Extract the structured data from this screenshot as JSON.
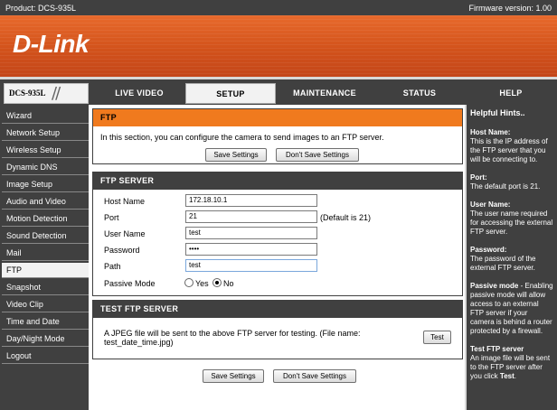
{
  "top": {
    "product": "Product: DCS-935L",
    "firmware": "Firmware version: 1.00"
  },
  "brand": {
    "logo": "D-Link"
  },
  "nav": {
    "model": "DCS-935L",
    "tabs": {
      "live": "LIVE VIDEO",
      "setup": "SETUP",
      "maintenance": "MAINTENANCE",
      "status": "STATUS",
      "help": "HELP"
    },
    "active": "SETUP"
  },
  "sidebar": {
    "items": [
      "Wizard",
      "Network Setup",
      "Wireless Setup",
      "Dynamic DNS",
      "Image Setup",
      "Audio and Video",
      "Motion Detection",
      "Sound Detection",
      "Mail",
      "FTP",
      "Snapshot",
      "Video Clip",
      "Time and Date",
      "Day/Night Mode",
      "Logout"
    ],
    "active": "FTP"
  },
  "ftp_box": {
    "title": "FTP",
    "description": "In this section, you can configure the camera to send images to an FTP server.",
    "save_label": "Save Settings",
    "dont_save_label": "Don't Save Settings"
  },
  "server_box": {
    "title": "FTP SERVER",
    "host_label": "Host Name",
    "host_value": "172.18.10.1",
    "port_label": "Port",
    "port_value": "21",
    "port_note": "(Default is 21)",
    "user_label": "User Name",
    "user_value": "test",
    "password_label": "Password",
    "password_value": "••••",
    "path_label": "Path",
    "path_value": "test",
    "passive_label": "Passive Mode",
    "yes_label": "Yes",
    "no_label": "No",
    "passive_selected": "No"
  },
  "test_box": {
    "title": "TEST FTP SERVER",
    "text_line1": "A JPEG file will be sent to the above FTP server for testing. (File name:",
    "text_line2": "test_date_time.jpg)",
    "test_label": "Test"
  },
  "bottom": {
    "save_label": "Save Settings",
    "dont_save_label": "Don't Save Settings"
  },
  "hints": {
    "title": "Helpful Hints..",
    "host_h": "Host Name:",
    "host_t": "This is the IP address of the FTP server that you will be connecting to.",
    "port_h": "Port:",
    "port_t": "The default port is 21.",
    "user_h": "User Name:",
    "user_t": "The user name required for accessing the external FTP server.",
    "pwd_h": "Password:",
    "pwd_t": "The password of the external FTP server.",
    "passive_h": "Passive mode",
    "passive_t": " - Enabling passive mode will allow access to an external FTP server if your camera is behind a router protected by a firewall.",
    "test_h": "Test FTP server",
    "test_t1": "An image file will be sent to the FTP server after you click ",
    "test_b": "Test",
    "test_t2": "."
  }
}
